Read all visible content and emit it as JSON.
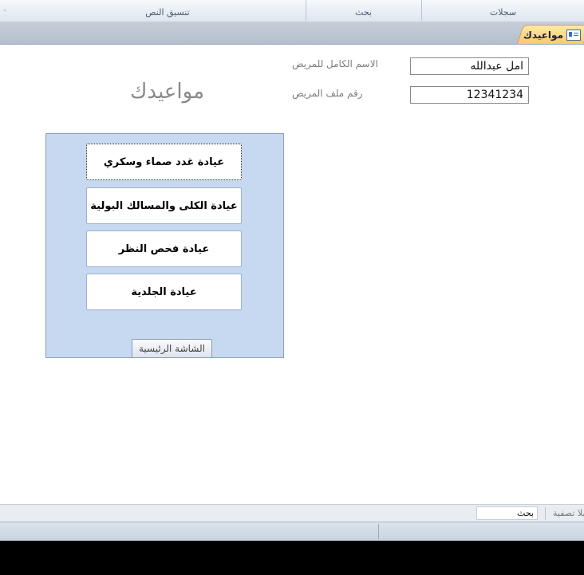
{
  "ribbon": {
    "groups": [
      "تنسيق النص",
      "بحث",
      "سجلات"
    ]
  },
  "doc_tab": {
    "label": "مواعيدك"
  },
  "form": {
    "title": "مواعيدك",
    "fields": [
      {
        "label": "الاسم الكامل للمريض",
        "value": "امل عبدالله"
      },
      {
        "label": "رقم ملف المريض",
        "value": "12341234"
      }
    ],
    "clinic_buttons": [
      "عيادة غدد صماء وسكري",
      "عيادة الكلى والمسالك البولية",
      "عيادة فحص النظر",
      "عيادة الجلدية"
    ],
    "home_button": "الشاشة الرئيسية"
  },
  "statusbar": {
    "filter_label": "بلا تصفية",
    "search_value": "بحث"
  }
}
